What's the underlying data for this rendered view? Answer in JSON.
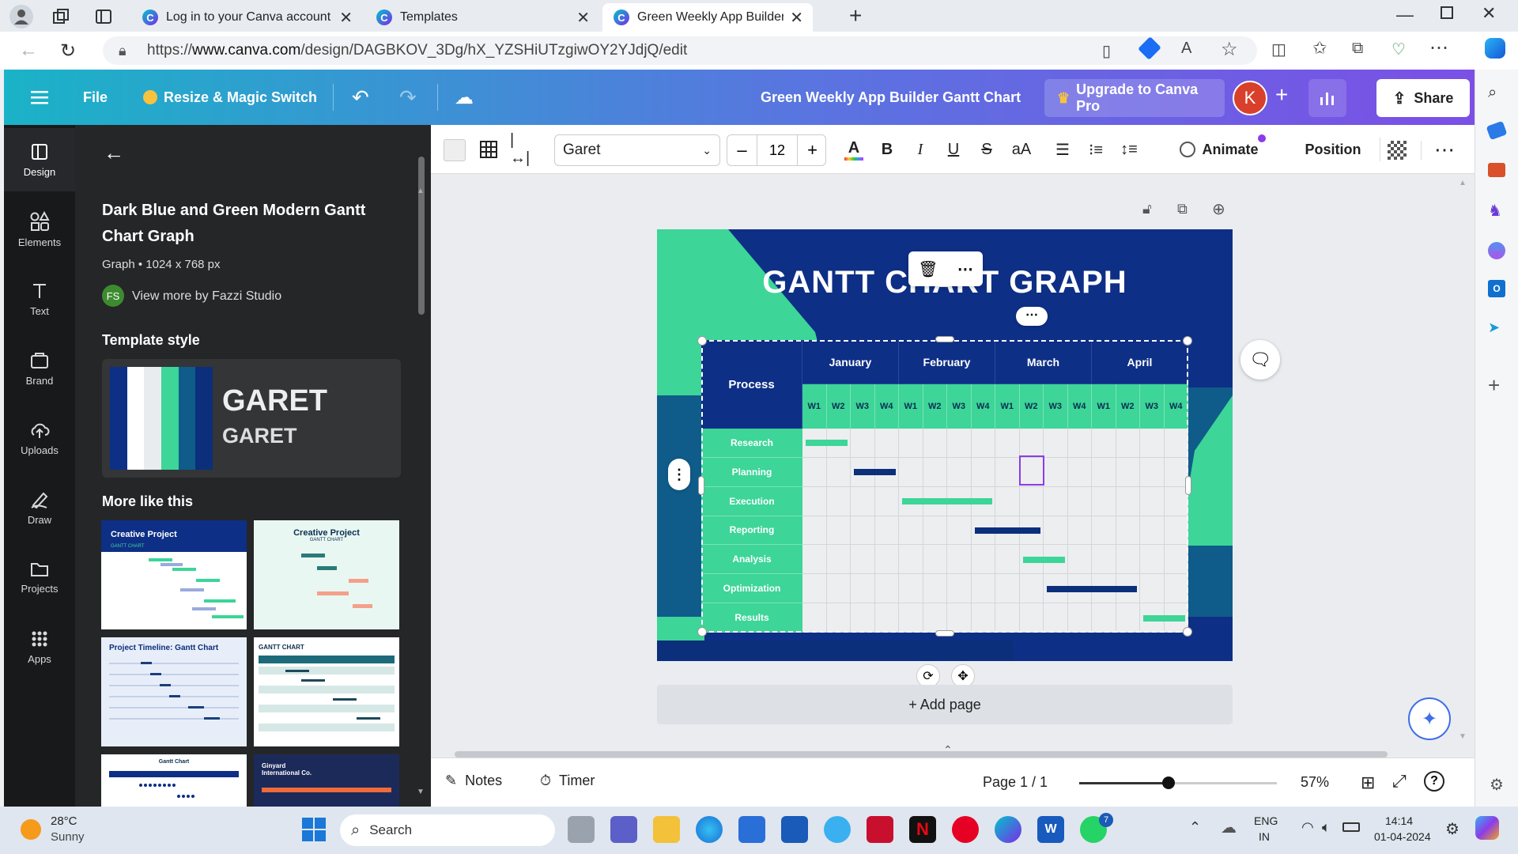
{
  "browser": {
    "tabs": [
      {
        "title": "Log in to your Canva account to",
        "active": false
      },
      {
        "title": "Templates",
        "active": false
      },
      {
        "title": "Green Weekly App Builder Gantt",
        "active": true
      }
    ],
    "url_prefix": "https://",
    "url_host": "www.canva.com",
    "url_path": "/design/DAGBKOV_3Dg/hX_YZSHiUTzgiwOY2YJdjQ/edit"
  },
  "header": {
    "file_label": "File",
    "resize_label": "Resize & Magic Switch",
    "doc_title": "Green Weekly App Builder Gantt Chart",
    "upgrade_label": "Upgrade to Canva Pro",
    "avatar_letter": "K",
    "share_label": "Share"
  },
  "rail": [
    {
      "label": "Design",
      "icon": "design-icon"
    },
    {
      "label": "Elements",
      "icon": "elements-icon"
    },
    {
      "label": "Text",
      "icon": "text-icon"
    },
    {
      "label": "Brand",
      "icon": "brand-icon"
    },
    {
      "label": "Uploads",
      "icon": "uploads-icon"
    },
    {
      "label": "Draw",
      "icon": "draw-icon"
    },
    {
      "label": "Projects",
      "icon": "projects-icon"
    },
    {
      "label": "Apps",
      "icon": "apps-icon"
    }
  ],
  "panel": {
    "template_title": "Dark Blue and Green Modern Gantt Chart Graph",
    "template_meta": "Graph • 1024 x 768 px",
    "author_initials": "FS",
    "author_link": "View more by Fazzi Studio",
    "style_heading": "Template style",
    "style_font_1": "GARET",
    "style_font_2": "GARET",
    "more_heading": "More like this",
    "thumbs": [
      {
        "title": "Creative Project",
        "subtitle": "GANTT CHART"
      },
      {
        "title": "Creative Project",
        "subtitle": "GANTT CHART"
      },
      {
        "title": "Project Timeline: Gantt Chart"
      },
      {
        "title": "GANTT CHART"
      },
      {
        "title": "Gantt Chart"
      },
      {
        "title": "Ginyard International Co."
      }
    ]
  },
  "toolbar": {
    "font": "Garet",
    "font_size": "12",
    "animate_label": "Animate",
    "position_label": "Position"
  },
  "gantt": {
    "title": "GANTT CHART GRAPH",
    "process_header": "Process",
    "months": [
      "January",
      "February",
      "March",
      "April"
    ],
    "weeks": [
      "W1",
      "W2",
      "W3",
      "W4",
      "W1",
      "W2",
      "W3",
      "W4",
      "W1",
      "W2",
      "W3",
      "W4",
      "W1",
      "W2",
      "W3",
      "W4"
    ],
    "rows": [
      "Research",
      "Planning",
      "Execution",
      "Reporting",
      "Analysis",
      "Optimization",
      "Results"
    ],
    "bars": [
      {
        "row": 0,
        "start": 0,
        "end": 2,
        "color": "green"
      },
      {
        "row": 1,
        "start": 2,
        "end": 4,
        "color": "navy"
      },
      {
        "row": 2,
        "start": 4,
        "end": 8,
        "color": "green"
      },
      {
        "row": 3,
        "start": 7,
        "end": 10,
        "color": "navy"
      },
      {
        "row": 4,
        "start": 9,
        "end": 11,
        "color": "green"
      },
      {
        "row": 5,
        "start": 10,
        "end": 14,
        "color": "navy"
      },
      {
        "row": 6,
        "start": 14,
        "end": 16,
        "color": "green"
      }
    ],
    "colors": {
      "green": "#3dd598",
      "navy": "#0b2f7a",
      "navy_bg": "#0e2f86",
      "teal_bg": "#0f5c8a"
    }
  },
  "workspace": {
    "add_page_label": "+ Add page"
  },
  "bottombar": {
    "notes_label": "Notes",
    "timer_label": "Timer",
    "page_label": "Page 1 / 1",
    "zoom_label": "57%",
    "zoom_fraction": 0.45
  },
  "taskbar": {
    "temp": "28°C",
    "weather": "Sunny",
    "search_placeholder": "Search",
    "lang_1": "ENG",
    "lang_2": "IN",
    "time": "14:14",
    "date": "01-04-2024",
    "whatsapp_badge": "7"
  }
}
